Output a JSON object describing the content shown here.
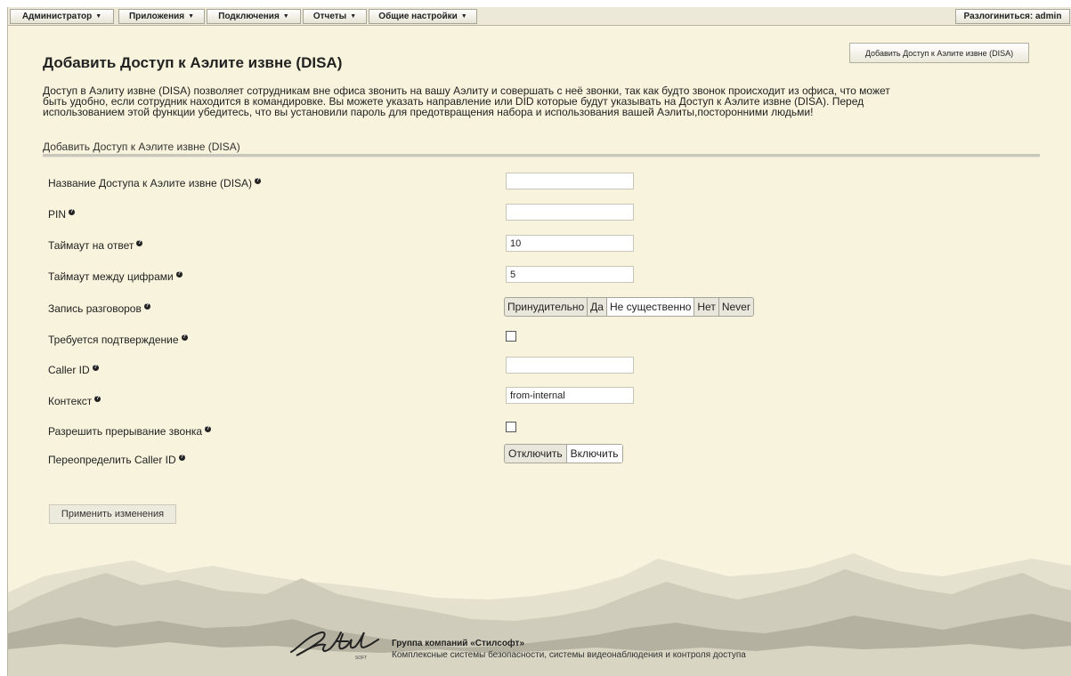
{
  "menu": {
    "items": [
      {
        "label": "Администратор"
      },
      {
        "label": "Приложения"
      },
      {
        "label": "Подключения"
      },
      {
        "label": "Отчеты"
      },
      {
        "label": "Общие настройки"
      }
    ],
    "logout_label": "Разлогиниться:",
    "username": "admin"
  },
  "header": {
    "add_button_label": "Добавить Доступ к Аэлите извне (DISA)",
    "title": "Добавить Доступ к Аэлите извне (DISA)",
    "description_lines": [
      "Доступ в Аэлиту извне (DISA) позволяет сотрудникам вне офиса звонить на вашу Аэлиту и совершать с неё звонки, так как будто звонок происходит из офиса, что может",
      "быть удобно, если сотрудник находится в командировке. Вы можете указать направление или DID которые будут указывать на Доступ к Аэлите извне (DISA). Перед",
      "использованием этой функции убедитесь, что вы установили пароль для предотвращения набора и использования вашей Аэлиты,посторонними людьми!"
    ]
  },
  "form": {
    "section_title": "Добавить Доступ к Аэлите извне (DISA)",
    "fields": {
      "name": {
        "label": "Название Доступа к Аэлите извне (DISA)",
        "value": ""
      },
      "pin": {
        "label": "PIN",
        "value": ""
      },
      "response_timeout": {
        "label": "Таймаут на ответ",
        "value": "10"
      },
      "digit_timeout": {
        "label": "Таймаут между цифрами",
        "value": "5"
      },
      "call_recording": {
        "label": "Запись разговоров",
        "options": [
          "Принудительно",
          "Да",
          "Не существенно",
          "Нет",
          "Never"
        ],
        "selected": "Не существенно"
      },
      "require_confirmation": {
        "label": "Требуется подтверждение",
        "checked": false
      },
      "caller_id": {
        "label": "Caller ID",
        "value": ""
      },
      "context": {
        "label": "Контекст",
        "value": "from-internal"
      },
      "allow_hangup": {
        "label": "Разрешить прерывание звонка",
        "checked": false
      },
      "override_caller_id": {
        "label": "Переопределить Caller ID",
        "options": [
          "Отключить",
          "Включить"
        ],
        "selected": "Включить"
      }
    },
    "apply_label": "Применить изменения"
  },
  "footer": {
    "company": "Группа компаний «Стилсофт»",
    "tagline": "Комплексные системы безопасности, системы видеонаблюдения и контроля доступа"
  },
  "colors": {
    "page_background": "#f7f3dc",
    "menubar_background": "#ece9d8"
  }
}
